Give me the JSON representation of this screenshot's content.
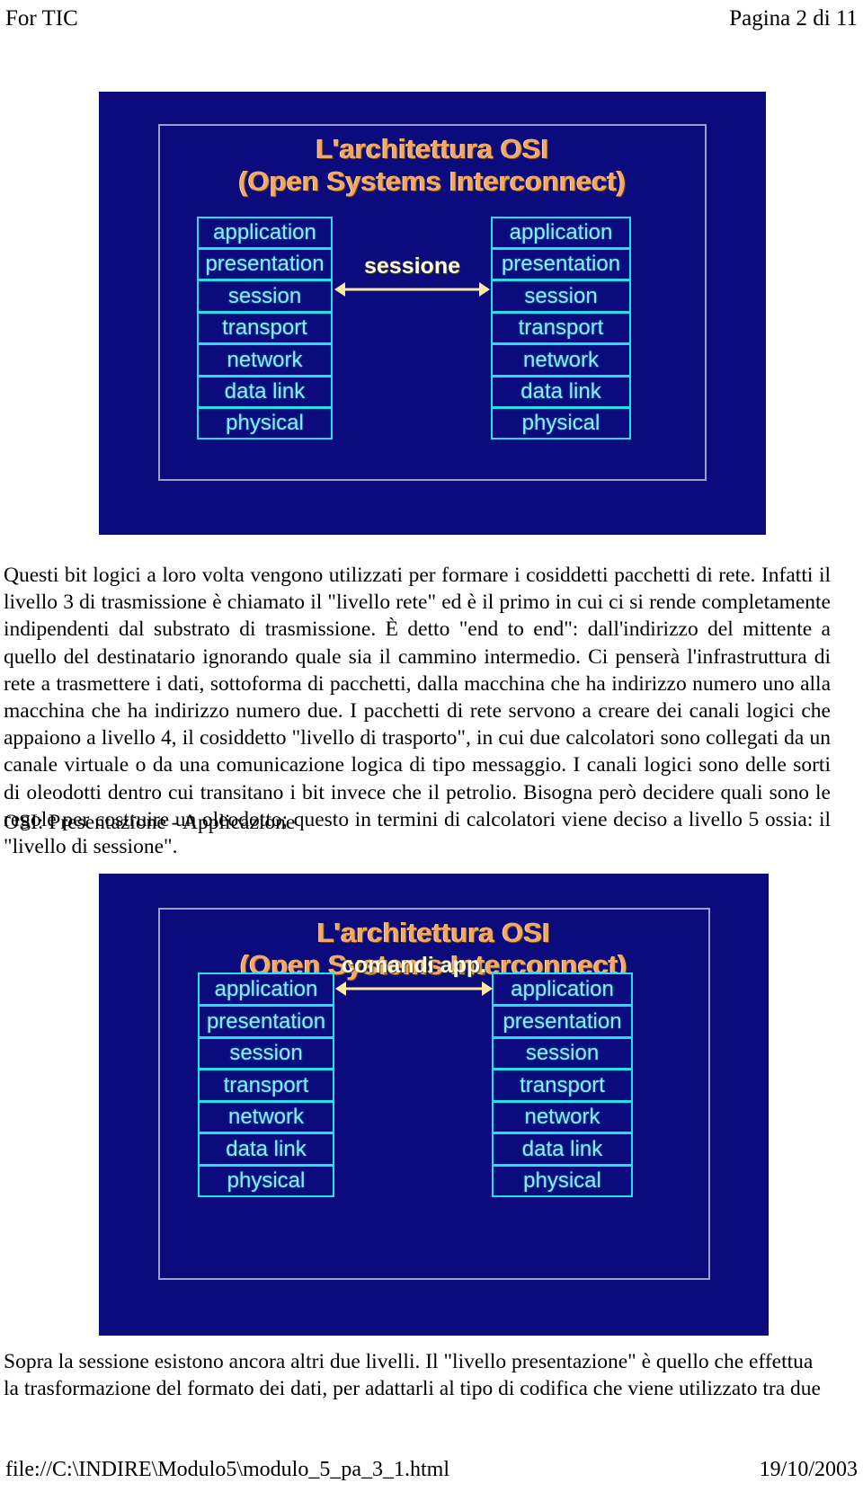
{
  "header": {
    "left": "For TIC",
    "right": "Pagina 2 di 11"
  },
  "footer": {
    "file_path": "file://C:\\INDIRE\\Modulo5\\modulo_5_pa_3_1.html",
    "date": "19/10/2003"
  },
  "slide_one": {
    "title_line1": "L'architettura OSI",
    "title_line2": "(Open Systems Interconnect)",
    "arrow_label": "sessione",
    "layers": [
      "application",
      "presentation",
      "session",
      "transport",
      "network",
      "data link",
      "physical"
    ],
    "colors": {
      "background": "#0b0b7e",
      "title": "#f0a868",
      "layer_border": "#22e0f0",
      "layer_text": "#8fe8ff",
      "arrow": "#ffe9a0",
      "frame": "#9aa0c8"
    }
  },
  "slide_two": {
    "title_line1": "L'architettura OSI",
    "title_line2": "(Open Systems Interconnect)",
    "arrow_label": "comandi app.",
    "layers": [
      "application",
      "presentation",
      "session",
      "transport",
      "network",
      "data link",
      "physical"
    ],
    "colors": {
      "background": "#0b0b7e",
      "title": "#f0a868",
      "layer_border": "#22e0f0",
      "layer_text": "#8fe8ff",
      "arrow": "#ffe9a0",
      "frame": "#9aa0c8"
    }
  },
  "content": {
    "paragraph_one": "Questi bit logici a loro volta vengono utilizzati per formare i cosiddetti pacchetti di rete. Infatti il livello 3 di trasmissione è chiamato il \"livello rete\" ed è il primo in cui ci si rende completamente indipendenti dal substrato di trasmissione. È detto \"end to end\": dall'indirizzo del mittente a quello del destinatario ignorando quale sia il cammino intermedio. Ci penserà l'infrastruttura di rete a trasmettere i dati, sottoforma di pacchetti, dalla macchina che ha indirizzo numero uno alla macchina che ha indirizzo numero due. I pacchetti di rete servono a creare dei canali logici che appaiono a livello 4, il cosiddetto \"livello di trasporto\", in cui due calcolatori sono collegati da un canale virtuale o da una comunicazione logica di tipo messaggio. I canali logici sono delle sorti di oleodotti dentro cui transitano i bit invece che il petrolio. Bisogna però decidere quali sono le regole per costruire un oleodotto; questo in termini di calcolatori viene deciso a livello 5 ossia: il \"livello di sessione\".",
    "section_label": "OSI: Presentazione - Applicazione",
    "paragraph_two": "Sopra la sessione esistono ancora altri due livelli. Il \"livello presentazione\" è quello che effettua la trasformazione del formato dei dati, per adattarli al tipo di codifica che viene utilizzato tra due"
  }
}
